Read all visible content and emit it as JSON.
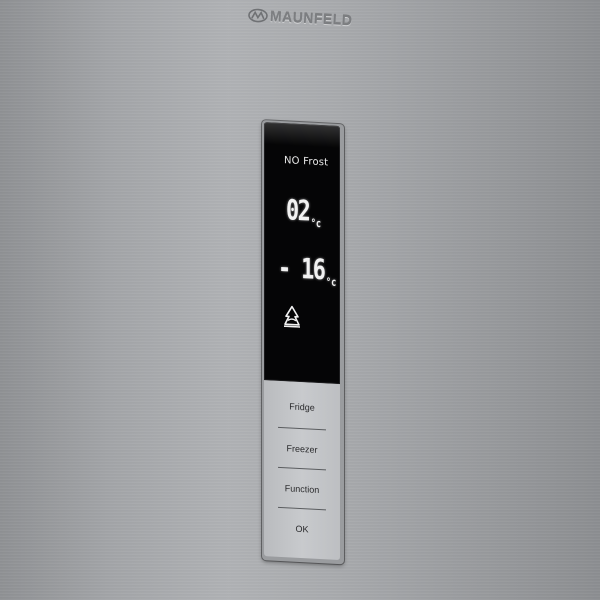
{
  "brand": {
    "name": "MAUNFELD",
    "logo_icon": "brand-emblem-icon"
  },
  "display": {
    "mode_label": "NO Frost",
    "fridge_temp": "02",
    "freezer_temp": "- 16",
    "unit": "°c",
    "mode_icon": "superfreeze-icon"
  },
  "buttons": [
    {
      "label": "Fridge"
    },
    {
      "label": "Freezer"
    },
    {
      "label": "Function"
    },
    {
      "label": "OK"
    }
  ],
  "colors": {
    "panel_screen": "#050506",
    "display_text": "#f2f2f2",
    "button_panel": "#c8cacd",
    "steel": "#a3a5a8"
  }
}
